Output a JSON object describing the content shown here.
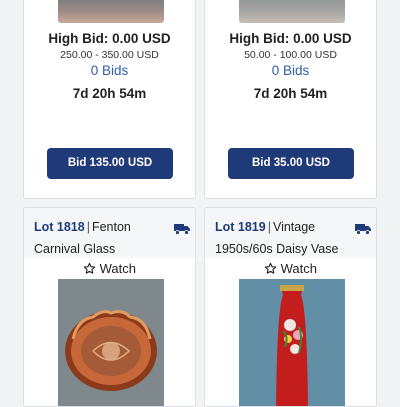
{
  "cards": [
    {
      "high_bid": "High Bid: 0.00 USD",
      "estimate": "250.00 - 350.00 USD",
      "bids": "0 Bids",
      "timer": "7d 20h 54m",
      "button": "Bid 135.00 USD"
    },
    {
      "high_bid": "High Bid: 0.00 USD",
      "estimate": "50.00 - 100.00 USD",
      "bids": "0 Bids",
      "timer": "7d 20h 54m",
      "button": "Bid 35.00 USD"
    },
    {
      "lot_number": "Lot 1818",
      "title_part1": "Fenton",
      "title_part2": "Carnival Glass",
      "watch": "Watch"
    },
    {
      "lot_number": "Lot 1819",
      "title_part1": "Vintage",
      "title_part2": "1950s/60s Daisy Vase",
      "watch": "Watch"
    }
  ],
  "icons": {
    "shipping": "truck-icon",
    "watch": "star-outline-icon"
  },
  "colors": {
    "accent": "#1f3a78",
    "bid_count": "#2f5fa8"
  }
}
